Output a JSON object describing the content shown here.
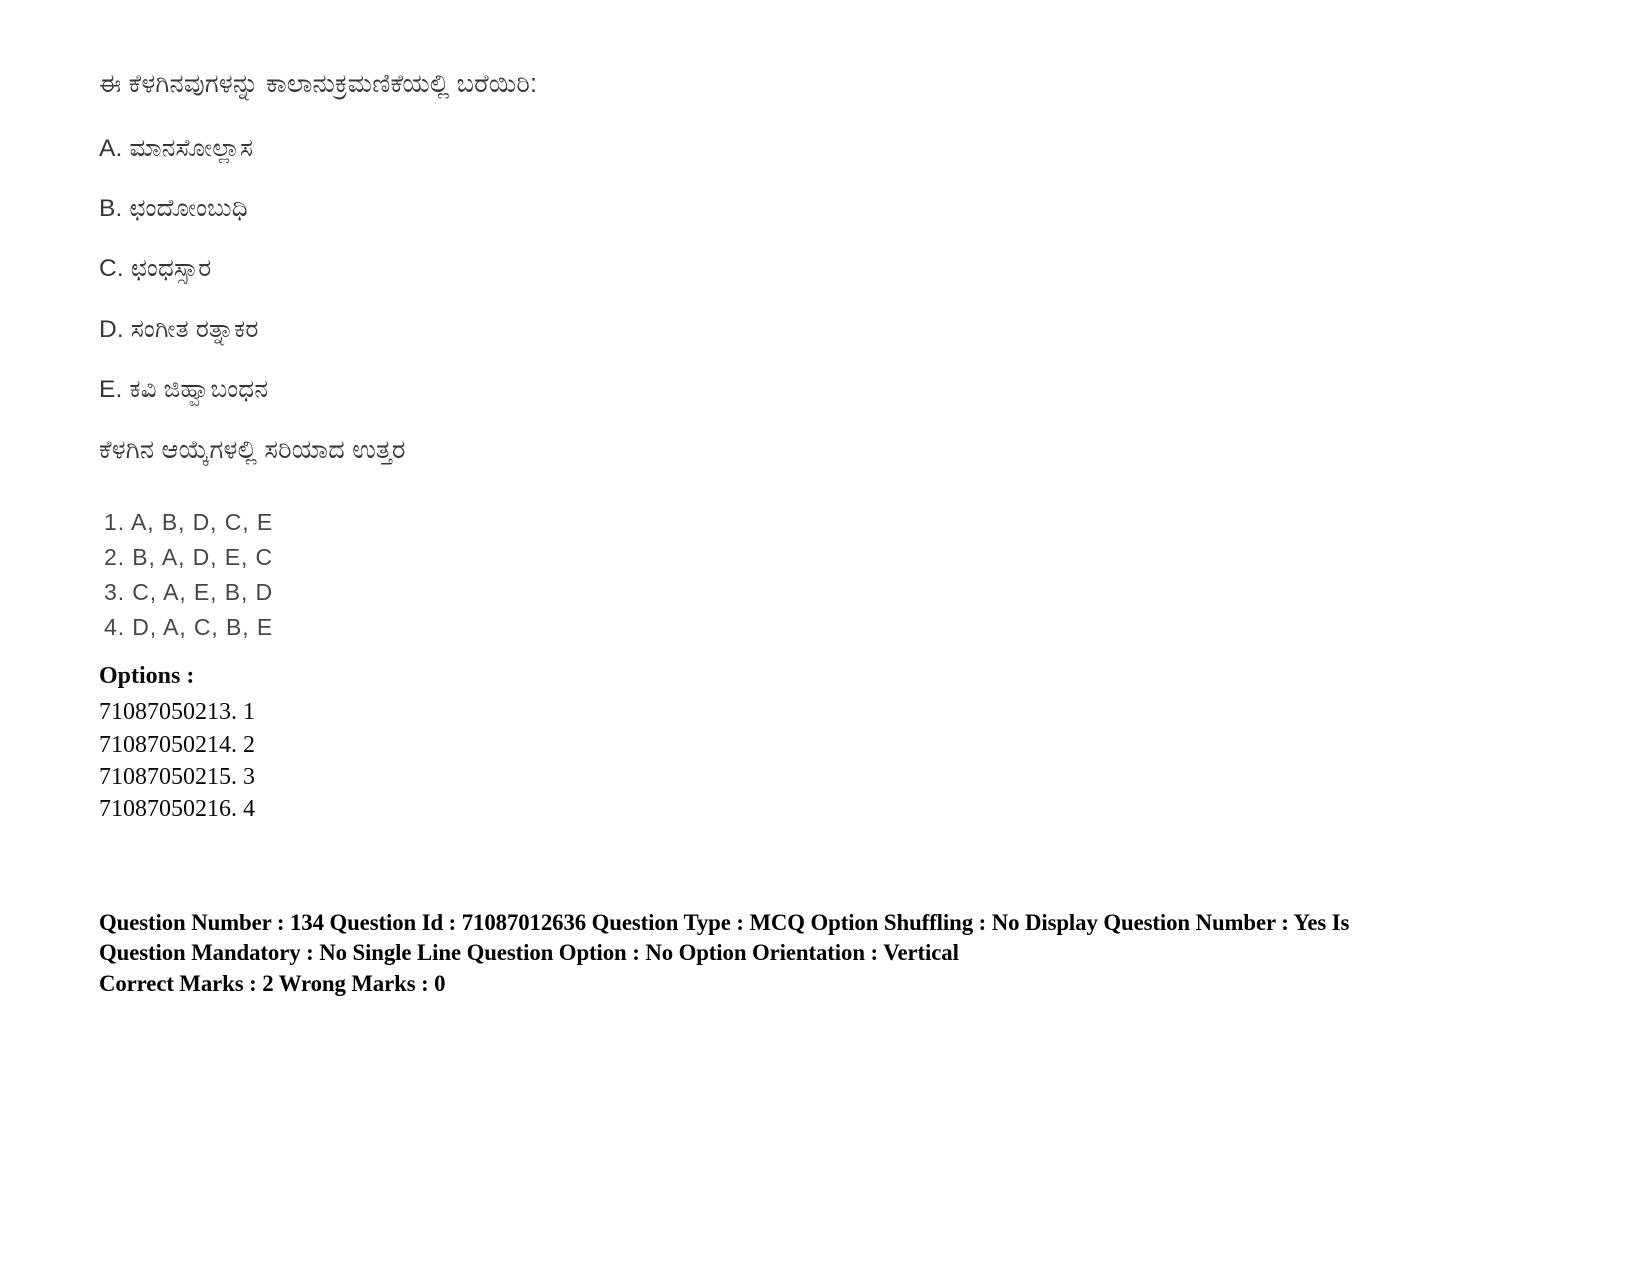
{
  "document": {
    "type": "exam-question-page",
    "language": "Kannada",
    "background_color": "#ffffff",
    "text_color": "#000000"
  },
  "question": {
    "stem": "ಈ ಕೆಳಗಿನವುಗಳನ್ನು ಕಾಲಾನುಕ್ರಮಣಿಕೆಯಲ್ಲಿ ಬರೆಯಿರಿ:",
    "items": [
      {
        "label": "A.",
        "text": "ಮಾನಸೋಲ್ಲಾಸ",
        "full": "A. ಮಾನಸೋಲ್ಲಾಸ"
      },
      {
        "label": "B.",
        "text": "ಛಂದೋಂಬುಧಿ",
        "full": "B. ಛಂದೋಂಬುಧಿ"
      },
      {
        "label": "C.",
        "text": "ಛಂಧಸ್ಸಾರ",
        "full": "C. ಛಂಧಸ್ಸಾರ"
      },
      {
        "label": "D.",
        "text": "ಸಂಗೀತ ರತ್ನಾಕರ",
        "full": "D. ಸಂಗೀತ ರತ್ನಾಕರ"
      },
      {
        "label": "E.",
        "text": "ಕವಿ ಜಿಹ್ವಾಬಂಧನ",
        "full": "E. ಕವಿ ಜಿಹ್ವಾಬಂಧನ"
      }
    ],
    "prompt": "ಕೆಳಗಿನ ಆಯ್ಕೆಗಳಲ್ಲಿ ಸರಿಯಾದ ಉತ್ತರ"
  },
  "choices": [
    {
      "number": "1.",
      "text": "A, B, D, C, E",
      "full": "1. A, B, D, C, E"
    },
    {
      "number": "2.",
      "text": "B, A, D, E, C",
      "full": "2. B, A, D, E, C"
    },
    {
      "number": "3.",
      "text": "C, A, E, B, D",
      "full": "3. C, A, E, B, D"
    },
    {
      "number": "4.",
      "text": "D, A, C, B, E",
      "full": "4. D, A, C, B, E"
    }
  ],
  "options_section": {
    "heading": "Options :",
    "rows": [
      {
        "id": "71087050213.",
        "value": "1",
        "full": "71087050213. 1"
      },
      {
        "id": "71087050214.",
        "value": "2",
        "full": "71087050214. 2"
      },
      {
        "id": "71087050215.",
        "value": "3",
        "full": "71087050215. 3"
      },
      {
        "id": "71087050216.",
        "value": "4",
        "full": "71087050216. 4"
      }
    ]
  },
  "metadata": {
    "question_number": "134",
    "question_id": "71087012636",
    "question_type": "MCQ",
    "option_shuffling": "No",
    "display_question_number": "Yes",
    "is_question_mandatory": "No",
    "single_line_question_option": "No",
    "option_orientation": "Vertical",
    "correct_marks": "2",
    "wrong_marks": "0",
    "line1": "Question Number : 134 Question Id : 71087012636 Question Type : MCQ Option Shuffling : No Display Question Number : Yes Is",
    "line2": "Question Mandatory : No Single Line Question Option : No Option Orientation : Vertical",
    "line3": "Correct Marks : 2 Wrong Marks : 0"
  }
}
